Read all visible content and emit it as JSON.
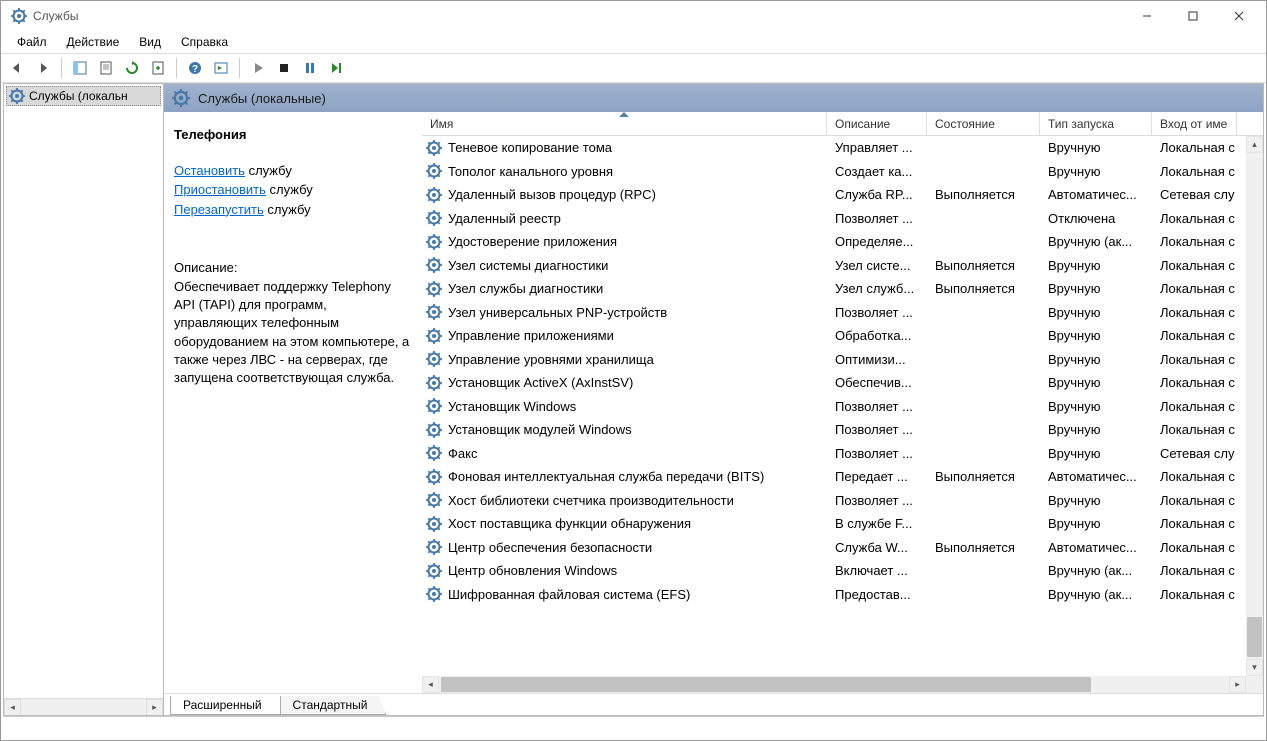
{
  "window": {
    "title": "Службы"
  },
  "menu": {
    "file": "Файл",
    "action": "Действие",
    "view": "Вид",
    "help": "Справка"
  },
  "tree": {
    "root": "Службы (локальн"
  },
  "header": {
    "title": "Службы (локальные)"
  },
  "detail": {
    "name": "Телефония",
    "stop_link": "Остановить",
    "stop_suffix": " службу",
    "pause_link": "Приостановить",
    "pause_suffix": " службу",
    "restart_link": "Перезапустить",
    "restart_suffix": " службу",
    "desc_label": "Описание:",
    "desc_text": "Обеспечивает поддержку Telephony API (TAPI) для программ, управляющих телефонным оборудованием на этом компьютере, а также через ЛВС - на серверах, где запущена соответствующая служба."
  },
  "columns": {
    "name": "Имя",
    "desc": "Описание",
    "state": "Состояние",
    "start": "Тип запуска",
    "logon": "Вход от име"
  },
  "services": [
    {
      "name": "Теневое копирование тома",
      "desc": "Управляет ...",
      "state": "",
      "start": "Вручную",
      "logon": "Локальная с"
    },
    {
      "name": "Тополог канального уровня",
      "desc": "Создает ка...",
      "state": "",
      "start": "Вручную",
      "logon": "Локальная с"
    },
    {
      "name": "Удаленный вызов процедур (RPC)",
      "desc": "Служба RP...",
      "state": "Выполняется",
      "start": "Автоматичес...",
      "logon": "Сетевая слу"
    },
    {
      "name": "Удаленный реестр",
      "desc": "Позволяет ...",
      "state": "",
      "start": "Отключена",
      "logon": "Локальная с"
    },
    {
      "name": "Удостоверение приложения",
      "desc": "Определяе...",
      "state": "",
      "start": "Вручную (ак...",
      "logon": "Локальная с"
    },
    {
      "name": "Узел системы диагностики",
      "desc": "Узел систе...",
      "state": "Выполняется",
      "start": "Вручную",
      "logon": "Локальная с"
    },
    {
      "name": "Узел службы диагностики",
      "desc": "Узел служб...",
      "state": "Выполняется",
      "start": "Вручную",
      "logon": "Локальная с"
    },
    {
      "name": "Узел универсальных PNP-устройств",
      "desc": "Позволяет ...",
      "state": "",
      "start": "Вручную",
      "logon": "Локальная с"
    },
    {
      "name": "Управление приложениями",
      "desc": "Обработка...",
      "state": "",
      "start": "Вручную",
      "logon": "Локальная с"
    },
    {
      "name": "Управление уровнями хранилища",
      "desc": "Оптимизи...",
      "state": "",
      "start": "Вручную",
      "logon": "Локальная с"
    },
    {
      "name": "Установщик ActiveX (AxInstSV)",
      "desc": "Обеспечив...",
      "state": "",
      "start": "Вручную",
      "logon": "Локальная с"
    },
    {
      "name": "Установщик Windows",
      "desc": "Позволяет ...",
      "state": "",
      "start": "Вручную",
      "logon": "Локальная с"
    },
    {
      "name": "Установщик модулей Windows",
      "desc": "Позволяет ...",
      "state": "",
      "start": "Вручную",
      "logon": "Локальная с"
    },
    {
      "name": "Факс",
      "desc": "Позволяет ...",
      "state": "",
      "start": "Вручную",
      "logon": "Сетевая слу"
    },
    {
      "name": "Фоновая интеллектуальная служба передачи (BITS)",
      "desc": "Передает ...",
      "state": "Выполняется",
      "start": "Автоматичес...",
      "logon": "Локальная с"
    },
    {
      "name": "Хост библиотеки счетчика производительности",
      "desc": "Позволяет ...",
      "state": "",
      "start": "Вручную",
      "logon": "Локальная с"
    },
    {
      "name": "Хост поставщика функции обнаружения",
      "desc": "В службе F...",
      "state": "",
      "start": "Вручную",
      "logon": "Локальная с"
    },
    {
      "name": "Центр обеспечения безопасности",
      "desc": "Служба W...",
      "state": "Выполняется",
      "start": "Автоматичес...",
      "logon": "Локальная с"
    },
    {
      "name": "Центр обновления Windows",
      "desc": "Включает ...",
      "state": "",
      "start": "Вручную (ак...",
      "logon": "Локальная с"
    },
    {
      "name": "Шифрованная файловая система (EFS)",
      "desc": "Предостав...",
      "state": "",
      "start": "Вручную (ак...",
      "logon": "Локальная с"
    }
  ],
  "tabs": {
    "extended": "Расширенный",
    "standard": "Стандартный"
  }
}
